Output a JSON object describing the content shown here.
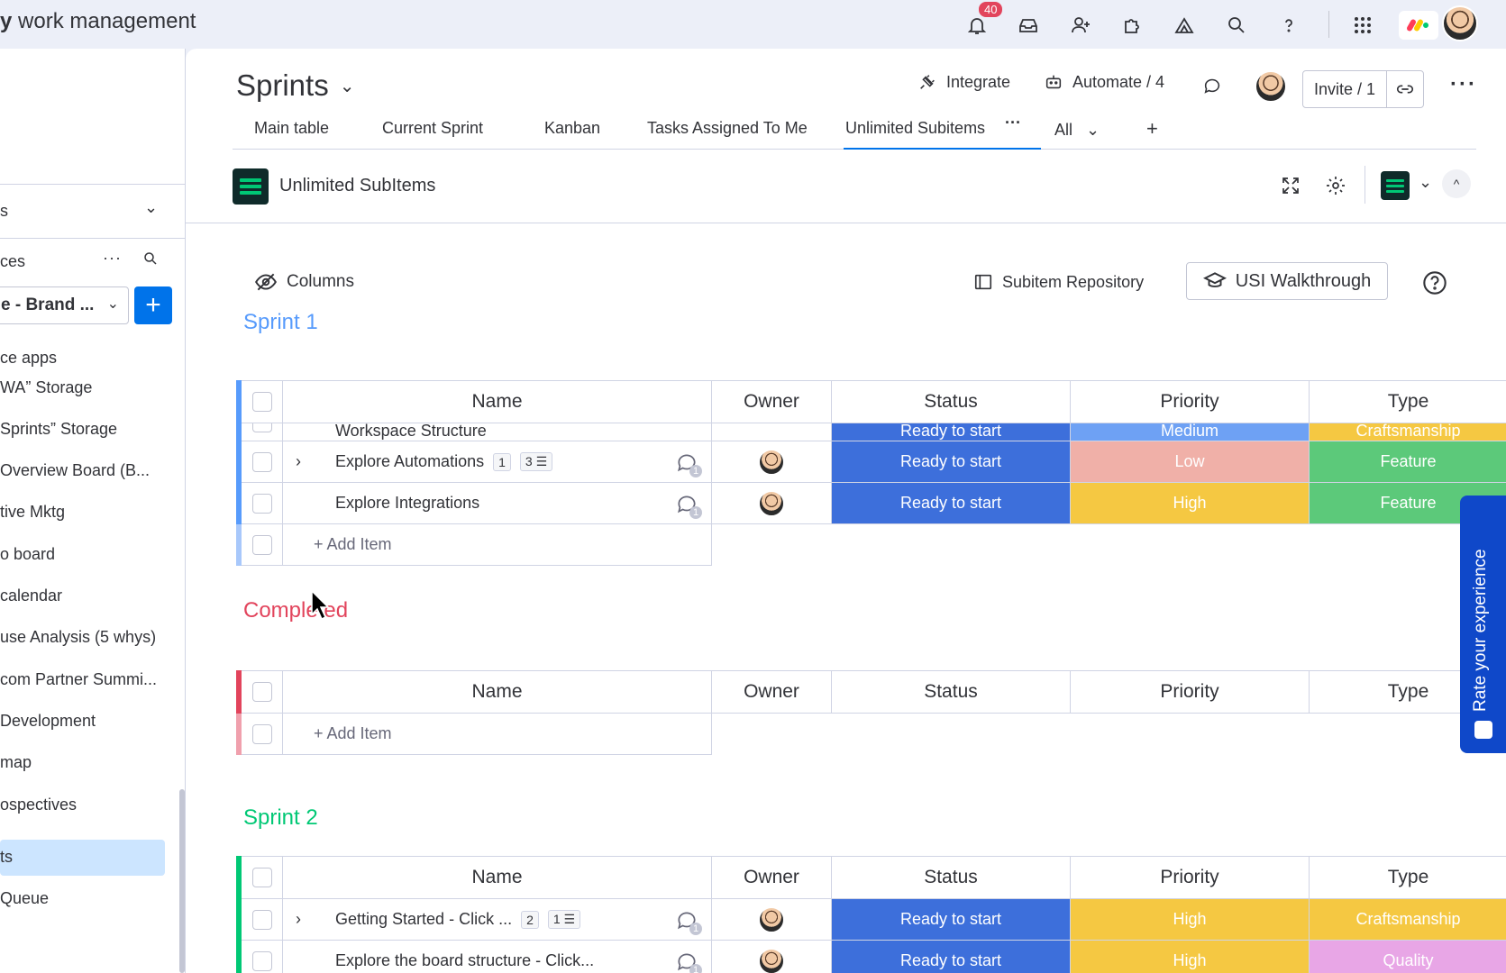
{
  "topbar": {
    "brand_bold": "y",
    "brand_rest": " work management",
    "notification_count": "40"
  },
  "sidebar": {
    "partial_label_1": "s",
    "partial_label_2": "ces",
    "workspace": "e - Brand ...",
    "items": [
      "ce apps",
      "WA” Storage",
      "Sprints” Storage",
      " Overview Board (B...",
      "tive Mktg",
      "o board",
      " calendar",
      "use Analysis (5 whys)",
      "com Partner Summi...",
      "Development",
      "map",
      "ospectives",
      "ts",
      " Queue"
    ]
  },
  "board": {
    "title": "Sprints",
    "integrate": "Integrate",
    "automate": "Automate / 4",
    "invite": "Invite / 1"
  },
  "tabs": [
    "Main table",
    "Current Sprint",
    "Kanban",
    "Tasks Assigned To Me",
    "Unlimited Subitems",
    "All",
    "+"
  ],
  "view": {
    "app_title": "Unlimited SubItems",
    "columns_label": "Columns",
    "repo_label": "Subitem Repository",
    "walkthrough_label": "USI Walkthrough"
  },
  "columns": [
    "Name",
    "Owner",
    "Status",
    "Priority",
    "Type"
  ],
  "groups": [
    {
      "title": "Sprint 1",
      "color": "#579bfc",
      "partial_row": {
        "name": "Workspace Structure",
        "status": "Ready to start",
        "priority": "Medium",
        "type": "Craftsmanship"
      },
      "rows": [
        {
          "name": "Explore Automations",
          "items": "1",
          "subitems": "3",
          "status": "Ready to start",
          "priority": "Low",
          "type": "Feature"
        },
        {
          "name": "Explore Integrations",
          "status": "Ready to start",
          "priority": "High",
          "type": "Feature"
        }
      ],
      "add_item": "+ Add Item"
    },
    {
      "title": "Completed",
      "color": "#e2445c",
      "add_item": "+ Add Item"
    },
    {
      "title": "Sprint 2",
      "color": "#00c875",
      "rows": [
        {
          "name": "Getting Started - Click ...",
          "items": "2",
          "subitems": "1",
          "status": "Ready to start",
          "priority": "High",
          "type": "Craftsmanship"
        },
        {
          "name": "Explore the board structure - Click...",
          "status": "Ready to start",
          "priority": "High",
          "type": "Quality"
        }
      ]
    }
  ],
  "chat_count": "1",
  "rate_label": "Rate your experience",
  "colors": {
    "accent": "#0073ea",
    "status_ready": "#3d6fdb",
    "priority_low": "#f0b0a8",
    "priority_high": "#f5c842",
    "priority_medium": "#6ea1f4",
    "type_feature": "#5cc97a",
    "type_craftsmanship": "#f5c842",
    "type_quality": "#e8a6e6"
  }
}
